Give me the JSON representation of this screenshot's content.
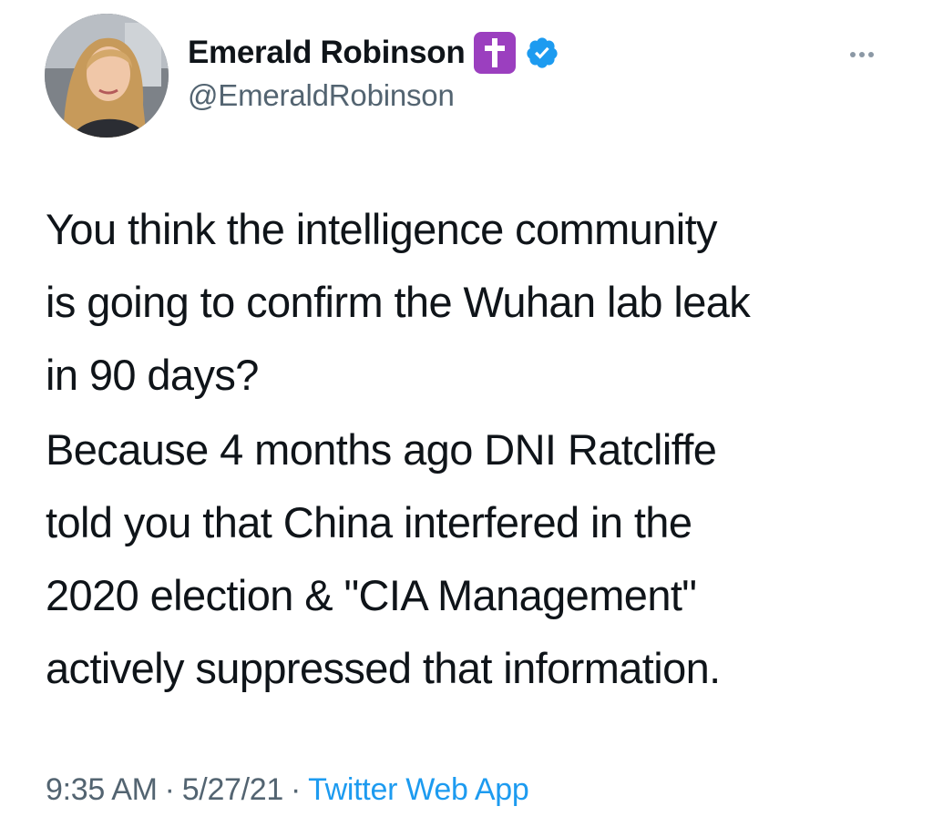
{
  "author": {
    "display_name": "Emerald Robinson",
    "name_emoji": "latin-cross-emoji",
    "verified": true,
    "handle": "@EmeraldRobinson",
    "avatar": "profile-photo"
  },
  "tweet": {
    "lines_p1": [
      "You think the intelligence community",
      "is going to confirm the Wuhan lab leak",
      "in 90 days?"
    ],
    "lines_p2": [
      "Because 4 months ago DNI Ratcliffe",
      "told you that China interfered in the",
      "2020 election & \"CIA Management\"",
      "actively suppressed that information."
    ]
  },
  "meta": {
    "time": "9:35 AM",
    "date": "5/27/21",
    "separator": "·",
    "source": "Twitter Web App"
  },
  "colors": {
    "text": "#0f1419",
    "secondary": "#536471",
    "link": "#1d9bf0",
    "cross_emoji_bg": "#9b3fbf",
    "verified": "#1d9bf0"
  },
  "icons": {
    "more": "more-horizontal-icon",
    "verified": "verified-badge-icon"
  }
}
